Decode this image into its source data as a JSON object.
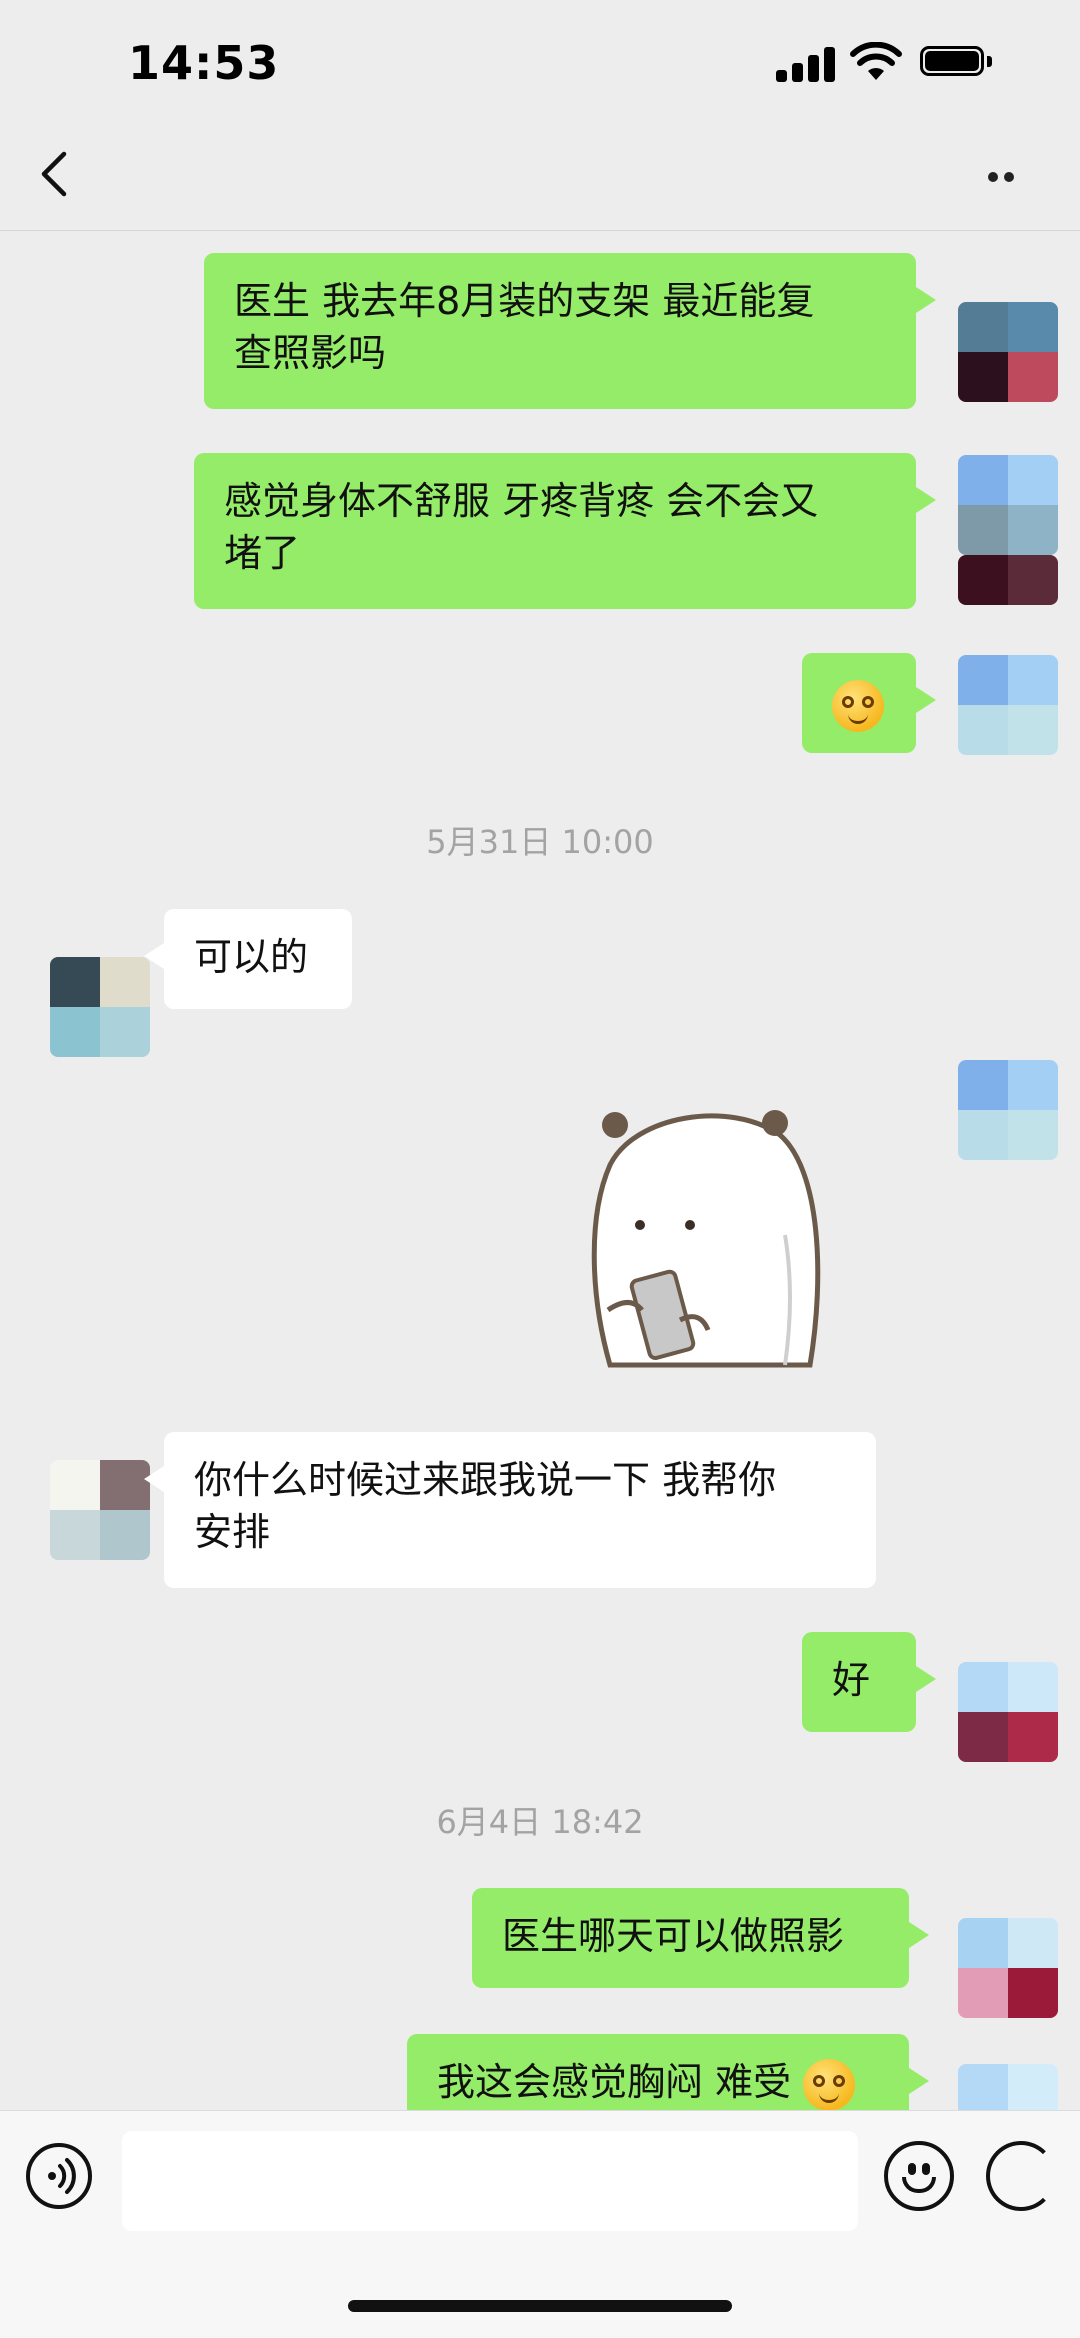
{
  "status_bar": {
    "time": "14:53"
  },
  "messages": [
    {
      "id": "m1",
      "direction": "out",
      "lines": [
        "医生 我去年8月装的支架 最近能复",
        "查照影吗"
      ]
    },
    {
      "id": "m2",
      "direction": "out",
      "lines": [
        "感觉身体不舒服 牙疼背疼 会不会又",
        "堵了"
      ]
    },
    {
      "id": "m3",
      "direction": "out",
      "emoji": "smile-emoji"
    },
    {
      "id": "t1",
      "type": "timestamp",
      "text": "5月31日 10:00"
    },
    {
      "id": "m4",
      "direction": "in",
      "lines": [
        "可以的"
      ]
    },
    {
      "id": "m5",
      "direction": "out",
      "sticker": "bear-with-phone-sticker"
    },
    {
      "id": "m6",
      "direction": "in",
      "lines": [
        "你什么时候过来跟我说一下 我帮你",
        "安排"
      ]
    },
    {
      "id": "m7",
      "direction": "out",
      "lines": [
        "好"
      ]
    },
    {
      "id": "t2",
      "type": "timestamp",
      "text": "6月4日 18:42"
    },
    {
      "id": "m8",
      "direction": "out",
      "lines": [
        "医生哪天可以做照影"
      ]
    },
    {
      "id": "m9",
      "direction": "out",
      "lines": [
        "我这会感觉胸闷 难受"
      ],
      "emoji": "smile-emoji"
    }
  ],
  "input_bar": {
    "placeholder": ""
  },
  "colors": {
    "outgoing_bubble": "#95ec69",
    "incoming_bubble": "#ffffff",
    "background": "#ededed"
  }
}
